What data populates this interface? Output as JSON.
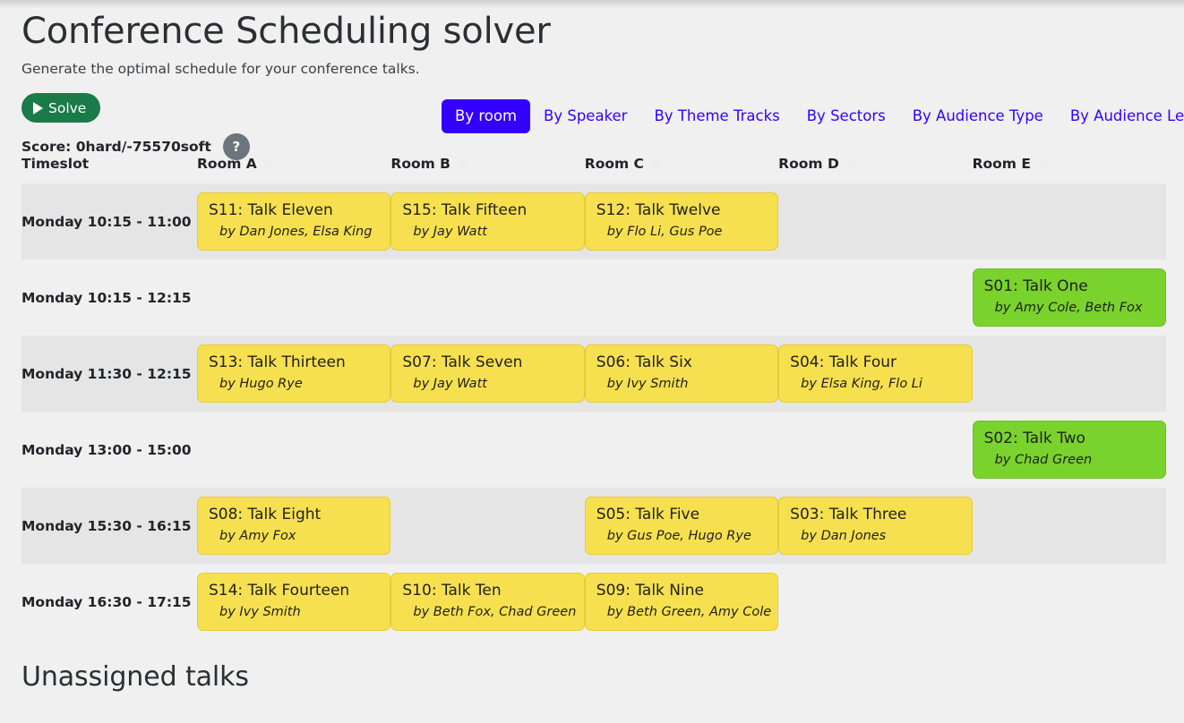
{
  "header": {
    "title": "Conference Scheduling solver",
    "subtitle": "Generate the optimal schedule for your conference talks."
  },
  "toolbar": {
    "solve_label": "Solve",
    "solve_icon": "play-icon",
    "score_label": "Score: 0hard/-75570soft",
    "help_label": "?",
    "solve_color": "#1a7a48",
    "help_color": "#6c757d"
  },
  "view_tabs": {
    "active_index": 0,
    "accent_color": "#3300ff",
    "items": [
      {
        "label": "By room"
      },
      {
        "label": "By Speaker"
      },
      {
        "label": "By Theme Tracks"
      },
      {
        "label": "By Sectors"
      },
      {
        "label": "By Audience Type"
      },
      {
        "label": "By Audience Level"
      }
    ]
  },
  "schedule": {
    "columns": [
      {
        "label": "Timeslot",
        "dot": false
      },
      {
        "label": "Room A",
        "dot": true
      },
      {
        "label": "Room B",
        "dot": true
      },
      {
        "label": "Room C",
        "dot": true
      },
      {
        "label": "Room D",
        "dot": true
      },
      {
        "label": "Room E",
        "dot": true
      }
    ],
    "dot_color": "#eeeeee",
    "card_colors": {
      "yellow": "#f6e04f",
      "green": "#79d32c"
    },
    "rows": [
      {
        "timeslot": "Monday 10:15 - 11:00",
        "stripe": true,
        "cells": [
          {
            "code": "S11",
            "name": "Talk Eleven",
            "title": "S11: Talk Eleven",
            "speakers": "by Dan Jones, Elsa King",
            "color": "yellow"
          },
          {
            "code": "S15",
            "name": "Talk Fifteen",
            "title": "S15: Talk Fifteen",
            "speakers": "by Jay Watt",
            "color": "yellow"
          },
          {
            "code": "S12",
            "name": "Talk Twelve",
            "title": "S12: Talk Twelve",
            "speakers": "by Flo Li, Gus Poe",
            "color": "yellow"
          },
          null,
          null
        ]
      },
      {
        "timeslot": "Monday 10:15 - 12:15",
        "stripe": false,
        "cells": [
          null,
          null,
          null,
          null,
          {
            "code": "S01",
            "name": "Talk One",
            "title": "S01: Talk One",
            "speakers": "by Amy Cole, Beth Fox",
            "color": "green"
          }
        ]
      },
      {
        "timeslot": "Monday 11:30 - 12:15",
        "stripe": true,
        "cells": [
          {
            "code": "S13",
            "name": "Talk Thirteen",
            "title": "S13: Talk Thirteen",
            "speakers": "by Hugo Rye",
            "color": "yellow"
          },
          {
            "code": "S07",
            "name": "Talk Seven",
            "title": "S07: Talk Seven",
            "speakers": "by Jay Watt",
            "color": "yellow"
          },
          {
            "code": "S06",
            "name": "Talk Six",
            "title": "S06: Talk Six",
            "speakers": "by Ivy Smith",
            "color": "yellow"
          },
          {
            "code": "S04",
            "name": "Talk Four",
            "title": "S04: Talk Four",
            "speakers": "by Elsa King, Flo Li",
            "color": "yellow"
          },
          null
        ]
      },
      {
        "timeslot": "Monday 13:00 - 15:00",
        "stripe": false,
        "cells": [
          null,
          null,
          null,
          null,
          {
            "code": "S02",
            "name": "Talk Two",
            "title": "S02: Talk Two",
            "speakers": "by Chad Green",
            "color": "green"
          }
        ]
      },
      {
        "timeslot": "Monday 15:30 - 16:15",
        "stripe": true,
        "cells": [
          {
            "code": "S08",
            "name": "Talk Eight",
            "title": "S08: Talk Eight",
            "speakers": "by Amy Fox",
            "color": "yellow"
          },
          null,
          {
            "code": "S05",
            "name": "Talk Five",
            "title": "S05: Talk Five",
            "speakers": "by Gus Poe, Hugo Rye",
            "color": "yellow"
          },
          {
            "code": "S03",
            "name": "Talk Three",
            "title": "S03: Talk Three",
            "speakers": "by Dan Jones",
            "color": "yellow"
          },
          null
        ]
      },
      {
        "timeslot": "Monday 16:30 - 17:15",
        "stripe": false,
        "cells": [
          {
            "code": "S14",
            "name": "Talk Fourteen",
            "title": "S14: Talk Fourteen",
            "speakers": "by Ivy Smith",
            "color": "yellow"
          },
          {
            "code": "S10",
            "name": "Talk Ten",
            "title": "S10: Talk Ten",
            "speakers": "by Beth Fox, Chad Green",
            "color": "yellow"
          },
          {
            "code": "S09",
            "name": "Talk Nine",
            "title": "S09: Talk Nine",
            "speakers": "by Beth Green, Amy Cole",
            "color": "yellow"
          },
          null,
          null
        ]
      }
    ]
  },
  "unassigned": {
    "title": "Unassigned talks"
  }
}
